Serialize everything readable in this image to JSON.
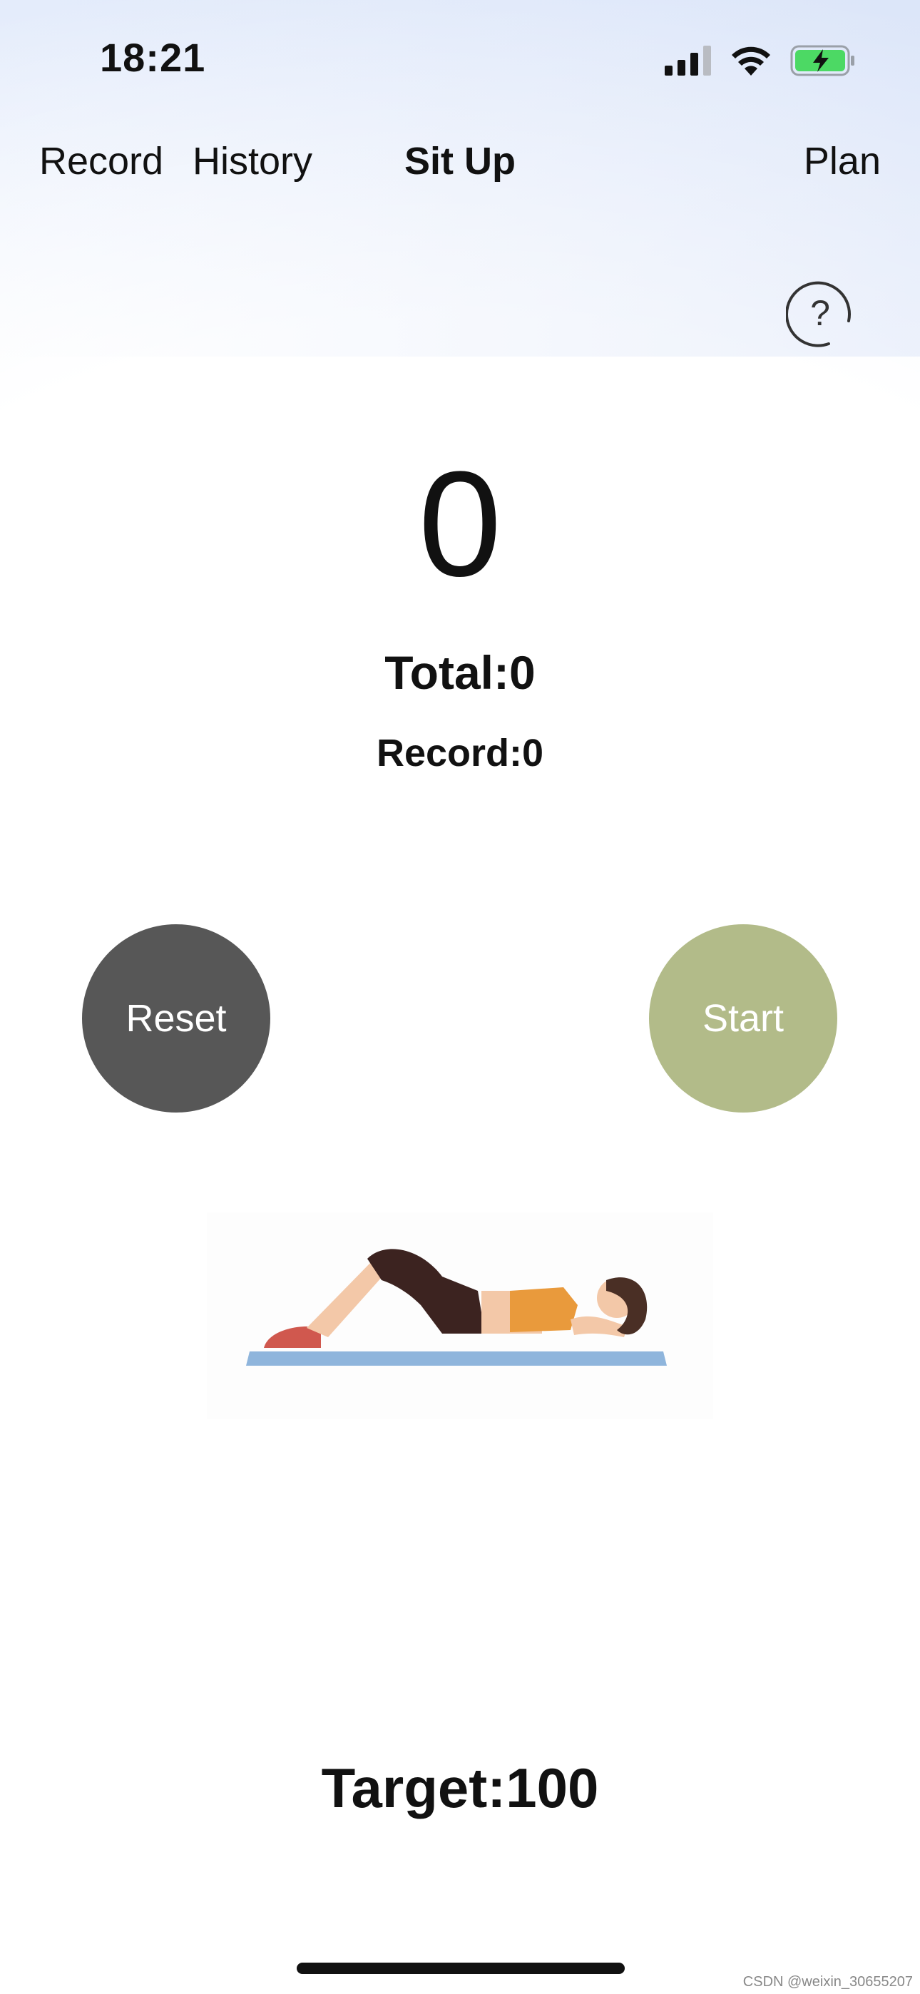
{
  "status_bar": {
    "time": "18:21",
    "icons": [
      "cellular-signal-icon",
      "wifi-icon",
      "battery-charging-icon"
    ],
    "battery_color": "#4cd964"
  },
  "nav": {
    "record_label": "Record",
    "history_label": "History",
    "title": "Sit Up",
    "plan_label": "Plan"
  },
  "help": {
    "icon": "question-icon",
    "glyph": "?"
  },
  "counter": {
    "value": "0",
    "total": "Total:0",
    "record": "Record:0"
  },
  "controls": {
    "reset_label": "Reset",
    "start_label": "Start",
    "reset_color": "#575757",
    "start_color": "#b2bb89"
  },
  "illustration": {
    "icon": "sit-up-illustration"
  },
  "target": {
    "label": "Target:100"
  },
  "watermark": "CSDN @weixin_30655207"
}
